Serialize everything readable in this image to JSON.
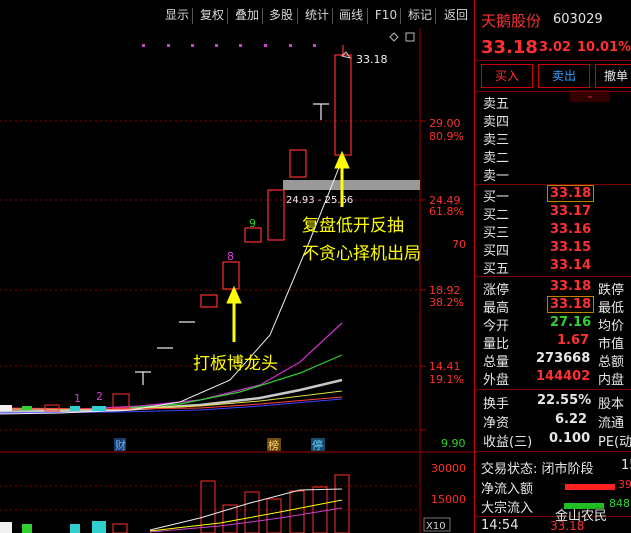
{
  "toolbar": {
    "items": [
      "显示",
      "复权",
      "叠加",
      "多股",
      "统计",
      "画线",
      "F10",
      "标记",
      "返回"
    ]
  },
  "stock": {
    "name": "天鹅股份",
    "code": "603029",
    "price": "33.18",
    "change": "3.02",
    "change_pct": "10.01%"
  },
  "actions": {
    "buy": "买入",
    "sell": "卖出",
    "cancel": "撤单"
  },
  "order_book": {
    "sell_labels": [
      "卖五",
      "卖四",
      "卖三",
      "卖二",
      "卖一"
    ],
    "buy": [
      {
        "label": "买一",
        "price": "33.18"
      },
      {
        "label": "买二",
        "price": "33.17"
      },
      {
        "label": "买三",
        "price": "33.16"
      },
      {
        "label": "买四",
        "price": "33.15"
      },
      {
        "label": "买五",
        "price": "33.14"
      }
    ]
  },
  "stats": {
    "rows": [
      {
        "label": "涨停",
        "value": "33.18",
        "label2": "跌停"
      },
      {
        "label": "最高",
        "value": "33.18",
        "label2": "最低"
      },
      {
        "label": "今开",
        "value": "27.16",
        "label2": "均价"
      },
      {
        "label": "量比",
        "value": "1.67",
        "label2": "市值"
      },
      {
        "label": "总量",
        "value": "273668",
        "label2": "总额"
      },
      {
        "label": "外盘",
        "value": "144402",
        "label2": "内盘"
      }
    ],
    "rows2": [
      {
        "label": "换手",
        "value": "22.55%",
        "label2": "股本"
      },
      {
        "label": "净资",
        "value": "6.22",
        "label2": "流通"
      },
      {
        "label": "收益(三)",
        "value": "0.100",
        "label2": "PE(动"
      }
    ]
  },
  "bottom_panel": {
    "trade_status": "交易状态: 闭市阶段",
    "trade_status_tail": "15",
    "net_inflow": "净流入额",
    "net_inflow_val": "39",
    "block_inflow": "大宗流入",
    "block_inflow_val": "848",
    "time": "14:54",
    "time_price": "33.18",
    "watermark": "金山农民"
  },
  "chart_data": {
    "type": "candlestick",
    "price_labels": [
      "29.00",
      "24.49",
      "18.92",
      "14.41",
      "9.90"
    ],
    "pct_labels": [
      "80.9%",
      "61.8%",
      "38.2%",
      "19.1%"
    ],
    "cut_label": "70",
    "high_label": "33.18",
    "range_label": "24.93 - 25.66",
    "candle_numbers": [
      "1",
      "2",
      "8",
      "9"
    ],
    "markers": [
      "财",
      "榜",
      "停"
    ],
    "volume_labels": [
      "30000",
      "15000"
    ],
    "volume_unit": "X10",
    "annotations": {
      "top": "复盘低开反抽",
      "top2": "不贪心择机出局",
      "bottom": "打板博龙头"
    }
  }
}
